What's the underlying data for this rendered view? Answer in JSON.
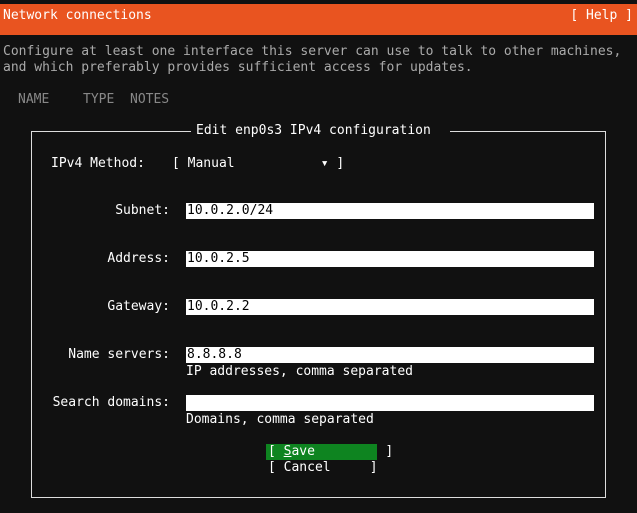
{
  "header": {
    "title": "Network connections",
    "help_label": "[ Help ]",
    "color": "#e95420"
  },
  "description": [
    "Configure at least one interface this server can use to talk to other machines,",
    "and which preferably provides sufficient access for updates."
  ],
  "columns": [
    "NAME",
    "TYPE",
    "NOTES"
  ],
  "dialog": {
    "title": "Edit enp0s3 IPv4 configuration",
    "method_label": "IPv4 Method:",
    "method_value": "[ Manual           ▾ ]",
    "fields": [
      {
        "label": "Subnet:",
        "value": "10.0.2.0/24",
        "hint": ""
      },
      {
        "label": "Address:",
        "value": "10.0.2.5",
        "hint": ""
      },
      {
        "label": "Gateway:",
        "value": "10.0.2.2",
        "hint": ""
      },
      {
        "label": "Name servers:",
        "value": "8.8.8.8",
        "hint": "IP addresses, comma separated"
      },
      {
        "label": "Search domains:",
        "value": "",
        "hint": "Domains, comma separated"
      }
    ],
    "save_open": "[ ",
    "save_hotkey": "S",
    "save_rest": "ave         ]",
    "cancel_label": "[ Cancel     ]",
    "save_color": "#0e8420"
  }
}
